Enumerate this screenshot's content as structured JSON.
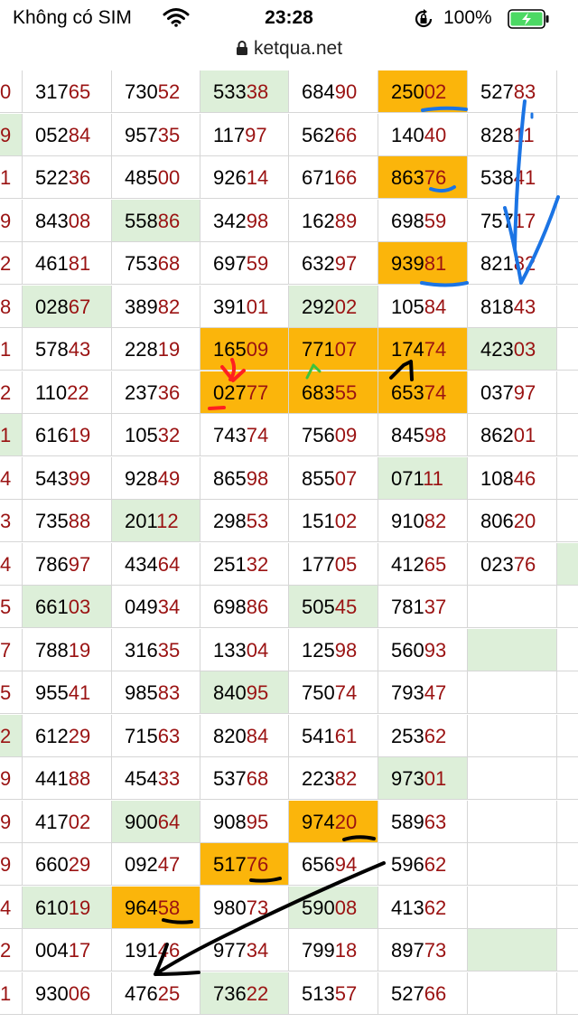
{
  "status_bar": {
    "carrier": "Không có SIM",
    "time": "23:28",
    "battery": "100%"
  },
  "url_bar": {
    "domain": "ketqua.net"
  },
  "colors": {
    "tail": "#9a1212",
    "highlight_green": "#ddefd9",
    "highlight_orange": "#fbb50b",
    "grid_line": "#d6d6d6"
  },
  "rows": [
    {
      "edge": "0",
      "cells": [
        [
          "317",
          "65",
          "w"
        ],
        [
          "730",
          "52",
          "w"
        ],
        [
          "533",
          "38",
          "g"
        ],
        [
          "684",
          "90",
          "w"
        ],
        [
          "250",
          "02",
          "o"
        ],
        [
          "527",
          "83",
          "w"
        ]
      ]
    },
    {
      "edge": "9",
      "edge_bg": "g",
      "cells": [
        [
          "052",
          "84",
          "w"
        ],
        [
          "957",
          "35",
          "w"
        ],
        [
          "117",
          "97",
          "w"
        ],
        [
          "562",
          "66",
          "w"
        ],
        [
          "140",
          "40",
          "w"
        ],
        [
          "828",
          "11",
          "w"
        ]
      ]
    },
    {
      "edge": "1",
      "cells": [
        [
          "522",
          "36",
          "w"
        ],
        [
          "485",
          "00",
          "w"
        ],
        [
          "926",
          "14",
          "w"
        ],
        [
          "671",
          "66",
          "w"
        ],
        [
          "863",
          "76",
          "o"
        ],
        [
          "538",
          "41",
          "w"
        ]
      ]
    },
    {
      "edge": "9",
      "cells": [
        [
          "843",
          "08",
          "w"
        ],
        [
          "558",
          "86",
          "g"
        ],
        [
          "342",
          "98",
          "w"
        ],
        [
          "162",
          "89",
          "w"
        ],
        [
          "698",
          "59",
          "w"
        ],
        [
          "757",
          "17",
          "w"
        ]
      ]
    },
    {
      "edge": "2",
      "cells": [
        [
          "461",
          "81",
          "w"
        ],
        [
          "753",
          "68",
          "w"
        ],
        [
          "697",
          "59",
          "w"
        ],
        [
          "632",
          "97",
          "w"
        ],
        [
          "939",
          "81",
          "o"
        ],
        [
          "821",
          "82",
          "w"
        ]
      ]
    },
    {
      "edge": "8",
      "cells": [
        [
          "028",
          "67",
          "g"
        ],
        [
          "389",
          "82",
          "w"
        ],
        [
          "391",
          "01",
          "w"
        ],
        [
          "292",
          "02",
          "g"
        ],
        [
          "105",
          "84",
          "w"
        ],
        [
          "818",
          "43",
          "w"
        ]
      ]
    },
    {
      "edge": "1",
      "cells": [
        [
          "578",
          "43",
          "w"
        ],
        [
          "228",
          "19",
          "w"
        ],
        [
          "165",
          "09",
          "o"
        ],
        [
          "771",
          "07",
          "o"
        ],
        [
          "174",
          "74",
          "o"
        ],
        [
          "423",
          "03",
          "g"
        ]
      ]
    },
    {
      "edge": "2",
      "cells": [
        [
          "110",
          "22",
          "w"
        ],
        [
          "237",
          "36",
          "w"
        ],
        [
          "027",
          "77",
          "o"
        ],
        [
          "683",
          "55",
          "o"
        ],
        [
          "653",
          "74",
          "o"
        ],
        [
          "037",
          "97",
          "w"
        ]
      ]
    },
    {
      "edge": "1",
      "edge_bg": "g",
      "cells": [
        [
          "616",
          "19",
          "w"
        ],
        [
          "105",
          "32",
          "w"
        ],
        [
          "743",
          "74",
          "w"
        ],
        [
          "756",
          "09",
          "w"
        ],
        [
          "845",
          "98",
          "w"
        ],
        [
          "862",
          "01",
          "w"
        ]
      ]
    },
    {
      "edge": "4",
      "cells": [
        [
          "543",
          "99",
          "w"
        ],
        [
          "928",
          "49",
          "w"
        ],
        [
          "865",
          "98",
          "w"
        ],
        [
          "855",
          "07",
          "w"
        ],
        [
          "071",
          "11",
          "g"
        ],
        [
          "108",
          "46",
          "w"
        ]
      ]
    },
    {
      "edge": "3",
      "cells": [
        [
          "735",
          "88",
          "w"
        ],
        [
          "201",
          "12",
          "g"
        ],
        [
          "298",
          "53",
          "w"
        ],
        [
          "151",
          "02",
          "w"
        ],
        [
          "910",
          "82",
          "w"
        ],
        [
          "806",
          "20",
          "w"
        ]
      ]
    },
    {
      "edge": "4",
      "cells": [
        [
          "786",
          "97",
          "w"
        ],
        [
          "434",
          "64",
          "w"
        ],
        [
          "251",
          "32",
          "w"
        ],
        [
          "177",
          "05",
          "w"
        ],
        [
          "412",
          "65",
          "w"
        ],
        [
          "023",
          "76",
          "w"
        ]
      ],
      "trail_bg": "g"
    },
    {
      "edge": "5",
      "cells": [
        [
          "661",
          "03",
          "g"
        ],
        [
          "049",
          "34",
          "w"
        ],
        [
          "698",
          "86",
          "w"
        ],
        [
          "505",
          "45",
          "g"
        ],
        [
          "781",
          "37",
          "w"
        ],
        [
          "",
          "",
          "w"
        ]
      ]
    },
    {
      "edge": "7",
      "cells": [
        [
          "788",
          "19",
          "w"
        ],
        [
          "316",
          "35",
          "w"
        ],
        [
          "133",
          "04",
          "w"
        ],
        [
          "125",
          "98",
          "w"
        ],
        [
          "560",
          "93",
          "w"
        ],
        [
          "",
          "",
          "g"
        ]
      ]
    },
    {
      "edge": "5",
      "cells": [
        [
          "955",
          "41",
          "w"
        ],
        [
          "985",
          "83",
          "w"
        ],
        [
          "840",
          "95",
          "g"
        ],
        [
          "750",
          "74",
          "w"
        ],
        [
          "793",
          "47",
          "w"
        ],
        [
          "",
          "",
          "w"
        ]
      ]
    },
    {
      "edge": "2",
      "edge_bg": "g",
      "cells": [
        [
          "612",
          "29",
          "w"
        ],
        [
          "715",
          "63",
          "w"
        ],
        [
          "820",
          "84",
          "w"
        ],
        [
          "541",
          "61",
          "w"
        ],
        [
          "253",
          "62",
          "w"
        ],
        [
          "",
          "",
          "w"
        ]
      ]
    },
    {
      "edge": "9",
      "cells": [
        [
          "441",
          "88",
          "w"
        ],
        [
          "454",
          "33",
          "w"
        ],
        [
          "537",
          "68",
          "w"
        ],
        [
          "223",
          "82",
          "w"
        ],
        [
          "973",
          "01",
          "g"
        ],
        [
          "",
          "",
          "w"
        ]
      ]
    },
    {
      "edge": "9",
      "cells": [
        [
          "417",
          "02",
          "w"
        ],
        [
          "900",
          "64",
          "g"
        ],
        [
          "908",
          "95",
          "w"
        ],
        [
          "974",
          "20",
          "o"
        ],
        [
          "589",
          "63",
          "w"
        ],
        [
          "",
          "",
          "w"
        ]
      ]
    },
    {
      "edge": "9",
      "cells": [
        [
          "660",
          "29",
          "w"
        ],
        [
          "092",
          "47",
          "w"
        ],
        [
          "517",
          "76",
          "o"
        ],
        [
          "656",
          "94",
          "w"
        ],
        [
          "596",
          "62",
          "w"
        ],
        [
          "",
          "",
          "w"
        ]
      ]
    },
    {
      "edge": "4",
      "cells": [
        [
          "610",
          "19",
          "g"
        ],
        [
          "964",
          "58",
          "o"
        ],
        [
          "980",
          "73",
          "w"
        ],
        [
          "590",
          "08",
          "g"
        ],
        [
          "413",
          "62",
          "w"
        ],
        [
          "",
          "",
          "w"
        ]
      ]
    },
    {
      "edge": "2",
      "cells": [
        [
          "004",
          "17",
          "w"
        ],
        [
          "191",
          "46",
          "w"
        ],
        [
          "977",
          "34",
          "w"
        ],
        [
          "799",
          "18",
          "w"
        ],
        [
          "897",
          "73",
          "w"
        ],
        [
          "",
          "",
          "g"
        ]
      ]
    },
    {
      "edge": "1",
      "cells": [
        [
          "930",
          "06",
          "w"
        ],
        [
          "476",
          "25",
          "w"
        ],
        [
          "736",
          "22",
          "g"
        ],
        [
          "513",
          "57",
          "w"
        ],
        [
          "527",
          "66",
          "w"
        ],
        [
          "",
          "",
          "w"
        ]
      ]
    }
  ]
}
